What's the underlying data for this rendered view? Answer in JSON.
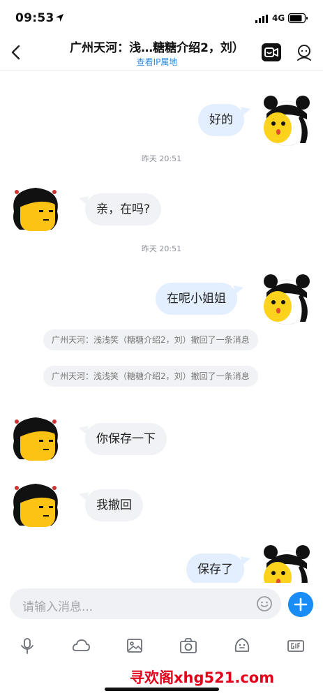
{
  "status_bar": {
    "time": "09:53",
    "network": "4G"
  },
  "header": {
    "title": "广州天河：浅…糖糖介绍2，刘）",
    "subtitle": "查看IP属地"
  },
  "messages": [
    {
      "kind": "self",
      "text": "好的"
    },
    {
      "kind": "time",
      "text": "昨天 20:51"
    },
    {
      "kind": "other",
      "text": "亲，在吗?"
    },
    {
      "kind": "time",
      "text": "昨天 20:51"
    },
    {
      "kind": "self",
      "text": "在呢小姐姐"
    },
    {
      "kind": "system",
      "text": "广州天河：浅浅笑（糖糖介绍2，刘）撤回了一条消息"
    },
    {
      "kind": "system",
      "text": "广州天河：浅浅笑（糖糖介绍2，刘）撤回了一条消息"
    },
    {
      "kind": "other",
      "text": "你保存一下"
    },
    {
      "kind": "other",
      "text": "我撤回"
    },
    {
      "kind": "self",
      "text": "保存了"
    }
  ],
  "input": {
    "placeholder": "请输入消息..."
  },
  "toolbar": [
    "mic-icon",
    "cloud-icon",
    "image-icon",
    "camera-icon",
    "sticker-icon",
    "gif-icon"
  ],
  "watermark": "寻欢阁xhg521.com",
  "colors": {
    "accent": "#1a8cf5",
    "self_bubble": "#e3efff",
    "other_bubble": "#f1f2f5",
    "link": "#2d8ae0"
  }
}
